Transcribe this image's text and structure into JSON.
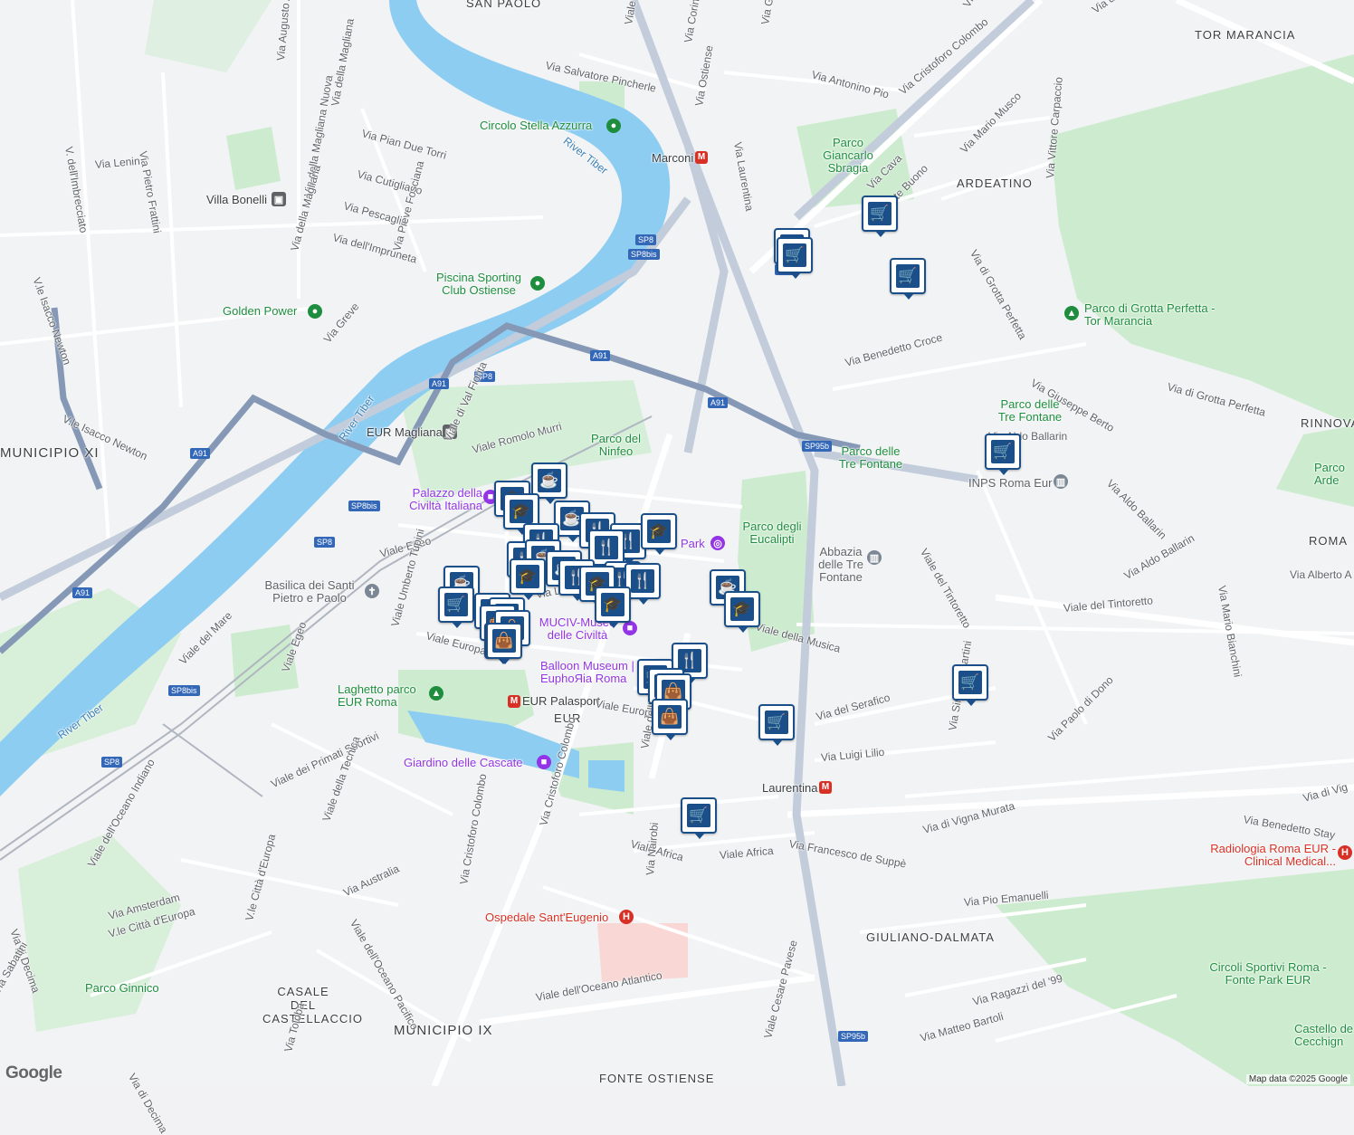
{
  "attribution": "Map data ©2025 Google",
  "logo": "Google",
  "districts": [
    "SAN PAOLO",
    "TOR MARANCIA",
    "ARDEATINO",
    "MUNICIPIO XI",
    "RINNOVA",
    "ROMA",
    "EUR",
    "GIULIANO-DALMATA",
    "CASALE DEL CASTELLACCIO",
    "MUNICIPIO IX",
    "FONTE OSTIENSE"
  ],
  "places": {
    "circolo": "Circolo Stella Azzurra",
    "piscina": "Piscina Sporting Club Ostiense",
    "golden": "Golden Power",
    "giancarlo": "Parco Giancarlo Sbragia",
    "grotta": "Parco di Grotta Perfetta - Tor Marancia",
    "tre_fontane_parco": "Parco delle Tre Fontane",
    "tre_fontane2": "Parco delle Tre Fontane",
    "ninfeo": "Parco del Ninfeo",
    "eucalipti": "Parco degli Eucalipti",
    "laghetto": "Laghetto parco EUR Roma",
    "ginnico": "Parco Ginnico",
    "circoli": "Circoli Sportivi Roma - Fonte Park EUR",
    "castello": "Castello de Cecchign",
    "parco_arde": "Parco Arde"
  },
  "museums": {
    "palazzo": "Palazzo della Civiltà Italiana",
    "muciv": "MUCIV-Museo delle Civiltà",
    "balloon": "Balloon Museum | EuphoЯia Roma",
    "giardino": "Giardino delle Cascate",
    "park": "Park"
  },
  "hospitals": {
    "eugenio": "Ospedale Sant'Eugenio",
    "radiologia": "Radiologia Roma EUR - Clinical Medical..."
  },
  "other_poi": {
    "abbazia": "Abbazia delle Tre Fontane",
    "inps": "INPS Roma Eur",
    "basilica": "Basilica dei Santi Pietro e Paolo"
  },
  "stations": {
    "marconi": "Marconi",
    "villa_bonelli": "Villa Bonelli",
    "eur_magliana": "EUR Magliana",
    "eur_palasport": "EUR Palasport",
    "laurentina": "Laurentina"
  },
  "rivers": [
    "River Tiber",
    "River Tiber",
    "River Tiber"
  ],
  "streets": [
    "Viale Guglielmo Marconi",
    "Via Salvatore Pincherle",
    "Via Corinto",
    "Via Ostiense",
    "Via Gabriello Chiabrera",
    "Via Antonino Pio",
    "Via Cristoforo Colombo",
    "Via Laurentina",
    "Via Mario Musco",
    "Via di Grotta Perfetta",
    "Via Vittore Carpaccio",
    "Via Fonte Buono",
    "Via Cava",
    "Via Giuseppe Berto",
    "Via Benedetto Croce",
    "Via di Grotta Perfetta",
    "Via Aldo Ballarin",
    "Via Aldo Ballarin",
    "Via Aldo Ballarin",
    "Viale del Tintoretto",
    "Viale del Tintoretto",
    "Via Mario Bianchini",
    "Via Alberto A",
    "Via Augusto Armellini",
    "Via della Magliana",
    "Via della Magliana Nuova",
    "V. dell'Imbrecciato",
    "Via Pietro Frattini",
    "Via Lenin",
    "Via Pian Due Torri",
    "Via Cutigliano",
    "Via Pescaglia",
    "Via dell'Impruneta",
    "Via Pieve Fosciana",
    "Via della Magliana",
    "V.le Isacco Newton",
    "V.le Isacco Newton",
    "Via Greve",
    "Viale di Val Fiorita",
    "Viale Romolo Murri",
    "Viale Egeo",
    "Viale Egeo",
    "Viale Umberto Tupini",
    "Viale Europa",
    "Viale Europa",
    "Via Liszt",
    "Viale della Musica",
    "Viale del Mare",
    "Viale dei Primati Sportivi",
    "Viale della Tecnica",
    "Via Cristoforo Colombo",
    "Via Cristoforo Colombo",
    "Viale dell'Arte",
    "Viale Africa",
    "Viale Africa",
    "Via Nairobi",
    "Viale dell'Oceano Indiano",
    "Viale dell'Oceano Pacifico",
    "Via Australia",
    "V.le Città d'Europa",
    "V.le Città d'Europa",
    "Via Amsterdam",
    "Via di Decima",
    "Via di Decima",
    "Via Sabatini",
    "Viale dell'Oceano Atlantico",
    "Via Toloba",
    "Viale Cesare Pavese",
    "Via Matteo Bartoli",
    "Via Ragazzi del '99",
    "Via Pio Emanuelli",
    "Via Francesco de Suppè",
    "Via di Vigna Murata",
    "Via Benedetto Stay",
    "Via di Vig",
    "Via del Serafico",
    "Via Luigi Lilio",
    "Via Simone Martini",
    "Via Paolo di Dono",
    "Via Titi",
    "Via dei Linc"
  ],
  "shields": [
    "SP8",
    "SP8bis",
    "SP8",
    "A91",
    "A91",
    "A91",
    "A91",
    "SP95b",
    "SP8bis",
    "SP8",
    "A91",
    "SP8bis",
    "SP8",
    "SP95b",
    "SP8"
  ],
  "marker_icons": {
    "cart": "shopping-cart",
    "bag": "shopping-bag",
    "cup": "coffee",
    "fork": "restaurant",
    "cap": "school"
  },
  "colors": {
    "marker": "#1a4f8a",
    "park": "#c8ebd2",
    "water": "#8ecdf2",
    "road": "#ffffff",
    "highway": "#b4bfd0",
    "motorway": "#7e8fa8"
  }
}
